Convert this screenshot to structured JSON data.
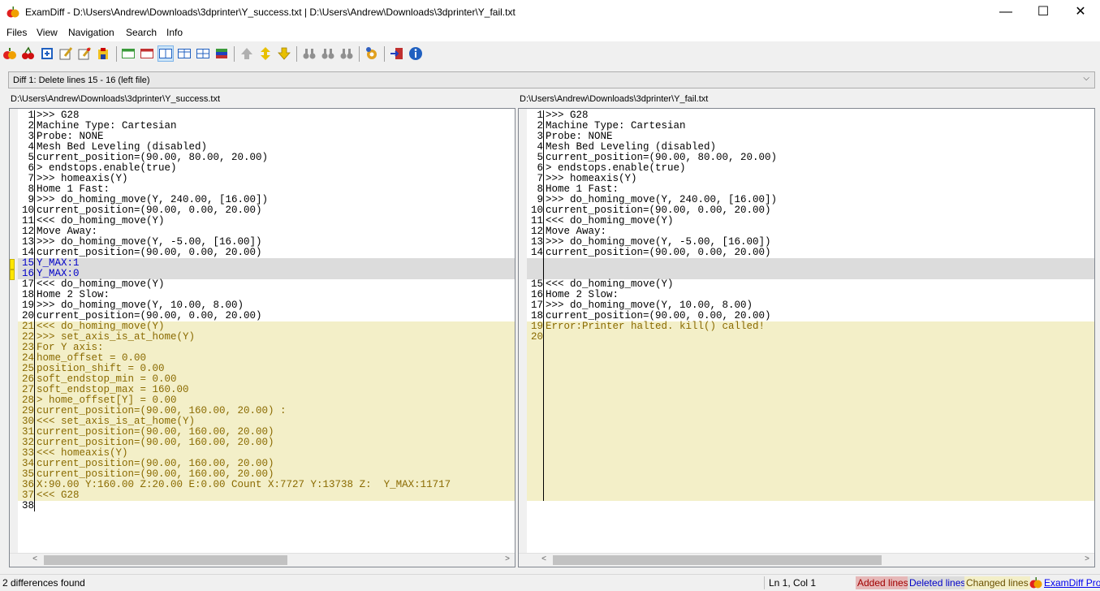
{
  "window": {
    "title": "ExamDiff - D:\\Users\\Andrew\\Downloads\\3dprinter\\Y_success.txt  |  D:\\Users\\Andrew\\Downloads\\3dprinter\\Y_fail.txt",
    "minimize": "—",
    "maximize": "☐",
    "close": "✕"
  },
  "menu": [
    "Files",
    "View",
    "Navigation",
    "Search",
    "Info"
  ],
  "diff_selector": "Diff 1: Delete lines 15 - 16 (left file)",
  "left": {
    "path": "D:\\Users\\Andrew\\Downloads\\3dprinter\\Y_success.txt",
    "lines": [
      {
        "n": "1",
        "t": ">>> G28",
        "k": "n"
      },
      {
        "n": "2",
        "t": "Machine Type: Cartesian",
        "k": "n"
      },
      {
        "n": "3",
        "t": "Probe: NONE",
        "k": "n"
      },
      {
        "n": "4",
        "t": "Mesh Bed Leveling (disabled)",
        "k": "n"
      },
      {
        "n": "5",
        "t": "current_position=(90.00, 80.00, 20.00)",
        "k": "n"
      },
      {
        "n": "6",
        "t": "> endstops.enable(true)",
        "k": "n"
      },
      {
        "n": "7",
        "t": ">>> homeaxis(Y)",
        "k": "n"
      },
      {
        "n": "8",
        "t": "Home 1 Fast:",
        "k": "n"
      },
      {
        "n": "9",
        "t": ">>> do_homing_move(Y, 240.00, [16.00])",
        "k": "n"
      },
      {
        "n": "10",
        "t": "current_position=(90.00, 0.00, 20.00)",
        "k": "n"
      },
      {
        "n": "11",
        "t": "<<< do_homing_move(Y)",
        "k": "n"
      },
      {
        "n": "12",
        "t": "Move Away:",
        "k": "n"
      },
      {
        "n": "13",
        "t": ">>> do_homing_move(Y, -5.00, [16.00])",
        "k": "n"
      },
      {
        "n": "14",
        "t": "current_position=(90.00, 0.00, 20.00)",
        "k": "n"
      },
      {
        "n": "15",
        "t": "Y_MAX:1",
        "k": "d"
      },
      {
        "n": "16",
        "t": "Y_MAX:0",
        "k": "d"
      },
      {
        "n": "17",
        "t": "<<< do_homing_move(Y)",
        "k": "n"
      },
      {
        "n": "18",
        "t": "Home 2 Slow:",
        "k": "n"
      },
      {
        "n": "19",
        "t": ">>> do_homing_move(Y, 10.00, 8.00)",
        "k": "n"
      },
      {
        "n": "20",
        "t": "current_position=(90.00, 0.00, 20.00)",
        "k": "n"
      },
      {
        "n": "21",
        "t": "<<< do_homing_move(Y)",
        "k": "c"
      },
      {
        "n": "22",
        "t": ">>> set_axis_is_at_home(Y)",
        "k": "c"
      },
      {
        "n": "23",
        "t": "For Y axis:",
        "k": "c"
      },
      {
        "n": "24",
        "t": "home_offset = 0.00",
        "k": "c"
      },
      {
        "n": "25",
        "t": "position_shift = 0.00",
        "k": "c"
      },
      {
        "n": "26",
        "t": "soft_endstop_min = 0.00",
        "k": "c"
      },
      {
        "n": "27",
        "t": "soft_endstop_max = 160.00",
        "k": "c"
      },
      {
        "n": "28",
        "t": "> home_offset[Y] = 0.00",
        "k": "c"
      },
      {
        "n": "29",
        "t": "current_position=(90.00, 160.00, 20.00) :",
        "k": "c"
      },
      {
        "n": "30",
        "t": "<<< set_axis_is_at_home(Y)",
        "k": "c"
      },
      {
        "n": "31",
        "t": "current_position=(90.00, 160.00, 20.00)",
        "k": "c"
      },
      {
        "n": "32",
        "t": "current_position=(90.00, 160.00, 20.00)",
        "k": "c"
      },
      {
        "n": "33",
        "t": "<<< homeaxis(Y)",
        "k": "c"
      },
      {
        "n": "34",
        "t": "current_position=(90.00, 160.00, 20.00)",
        "k": "c"
      },
      {
        "n": "35",
        "t": "current_position=(90.00, 160.00, 20.00)",
        "k": "c"
      },
      {
        "n": "36",
        "t": "X:90.00 Y:160.00 Z:20.00 E:0.00 Count X:7727 Y:13738 Z:  Y_MAX:11717",
        "k": "c"
      },
      {
        "n": "37",
        "t": "<<< G28",
        "k": "c"
      },
      {
        "n": "38",
        "t": "",
        "k": "n"
      }
    ]
  },
  "right": {
    "path": "D:\\Users\\Andrew\\Downloads\\3dprinter\\Y_fail.txt",
    "lines": [
      {
        "n": "1",
        "t": ">>> G28",
        "k": "n"
      },
      {
        "n": "2",
        "t": "Machine Type: Cartesian",
        "k": "n"
      },
      {
        "n": "3",
        "t": "Probe: NONE",
        "k": "n"
      },
      {
        "n": "4",
        "t": "Mesh Bed Leveling (disabled)",
        "k": "n"
      },
      {
        "n": "5",
        "t": "current_position=(90.00, 80.00, 20.00)",
        "k": "n"
      },
      {
        "n": "6",
        "t": "> endstops.enable(true)",
        "k": "n"
      },
      {
        "n": "7",
        "t": ">>> homeaxis(Y)",
        "k": "n"
      },
      {
        "n": "8",
        "t": "Home 1 Fast:",
        "k": "n"
      },
      {
        "n": "9",
        "t": ">>> do_homing_move(Y, 240.00, [16.00])",
        "k": "n"
      },
      {
        "n": "10",
        "t": "current_position=(90.00, 0.00, 20.00)",
        "k": "n"
      },
      {
        "n": "11",
        "t": "<<< do_homing_move(Y)",
        "k": "n"
      },
      {
        "n": "12",
        "t": "Move Away:",
        "k": "n"
      },
      {
        "n": "13",
        "t": ">>> do_homing_move(Y, -5.00, [16.00])",
        "k": "n"
      },
      {
        "n": "14",
        "t": "current_position=(90.00, 0.00, 20.00)",
        "k": "n"
      },
      {
        "n": "",
        "t": "",
        "k": "p"
      },
      {
        "n": "",
        "t": "",
        "k": "p"
      },
      {
        "n": "15",
        "t": "<<< do_homing_move(Y)",
        "k": "n"
      },
      {
        "n": "16",
        "t": "Home 2 Slow:",
        "k": "n"
      },
      {
        "n": "17",
        "t": ">>> do_homing_move(Y, 10.00, 8.00)",
        "k": "n"
      },
      {
        "n": "18",
        "t": "current_position=(90.00, 0.00, 20.00)",
        "k": "n"
      },
      {
        "n": "19",
        "t": "Error:Printer halted. kill() called!",
        "k": "c"
      },
      {
        "n": "20",
        "t": "",
        "k": "c"
      },
      {
        "n": "",
        "t": "",
        "k": "c"
      },
      {
        "n": "",
        "t": "",
        "k": "c"
      },
      {
        "n": "",
        "t": "",
        "k": "c"
      },
      {
        "n": "",
        "t": "",
        "k": "c"
      },
      {
        "n": "",
        "t": "",
        "k": "c"
      },
      {
        "n": "",
        "t": "",
        "k": "c"
      },
      {
        "n": "",
        "t": "",
        "k": "c"
      },
      {
        "n": "",
        "t": "",
        "k": "c"
      },
      {
        "n": "",
        "t": "",
        "k": "c"
      },
      {
        "n": "",
        "t": "",
        "k": "c"
      },
      {
        "n": "",
        "t": "",
        "k": "c"
      },
      {
        "n": "",
        "t": "",
        "k": "c"
      },
      {
        "n": "",
        "t": "",
        "k": "c"
      },
      {
        "n": "",
        "t": "",
        "k": "c"
      },
      {
        "n": "",
        "t": "",
        "k": "c"
      }
    ]
  },
  "status": {
    "differences": "2 differences found",
    "position": "Ln 1, Col 1",
    "added": "Added lines",
    "deleted": "Deleted lines",
    "changed": "Changed lines",
    "pro": "ExamDiff Pro"
  },
  "colors": {
    "added_bg": "#e6b8b8",
    "deleted_bg": "#dcdcdc",
    "changed_bg": "#f3efc8",
    "deleted_text": "#0000c8",
    "changed_text": "#8a6a00"
  }
}
